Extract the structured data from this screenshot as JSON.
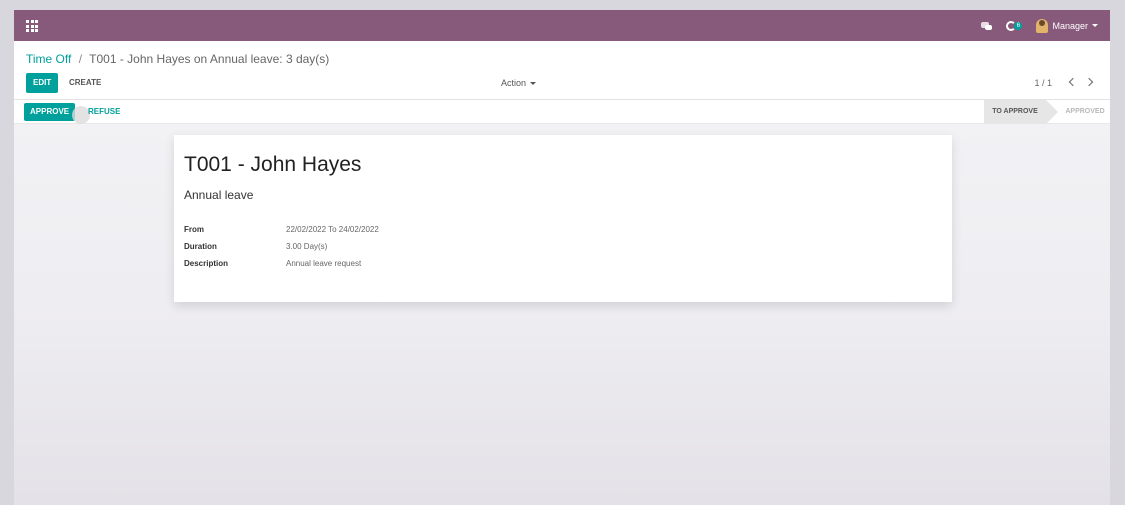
{
  "navbar": {
    "apps_icon": "apps-grid-icon",
    "chat_icon": "chat-icon",
    "activity_icon": "activity-icon",
    "activity_badge": "6",
    "user_name": "Manager",
    "brand_color": "#875a7b"
  },
  "breadcrumb": {
    "parent": "Time Off",
    "separator": "/",
    "current": "T001 - John Hayes on Annual leave: 3 day(s)"
  },
  "buttons": {
    "edit": "EDIT",
    "create": "CREATE",
    "action": "Action",
    "approve": "APPROVE",
    "refuse": "REFUSE"
  },
  "pager": {
    "value": "1 / 1"
  },
  "status": {
    "active_stage": "TO APPROVE",
    "next_stage": "APPROVED"
  },
  "record": {
    "title": "T001 - John Hayes",
    "leave_type": "Annual leave",
    "fields": [
      {
        "label": "From",
        "value": "22/02/2022 To 24/02/2022"
      },
      {
        "label": "Duration",
        "value": "3.00 Day(s)"
      },
      {
        "label": "Description",
        "value": "Annual leave request"
      }
    ]
  },
  "colors": {
    "accent": "#00a09d"
  }
}
